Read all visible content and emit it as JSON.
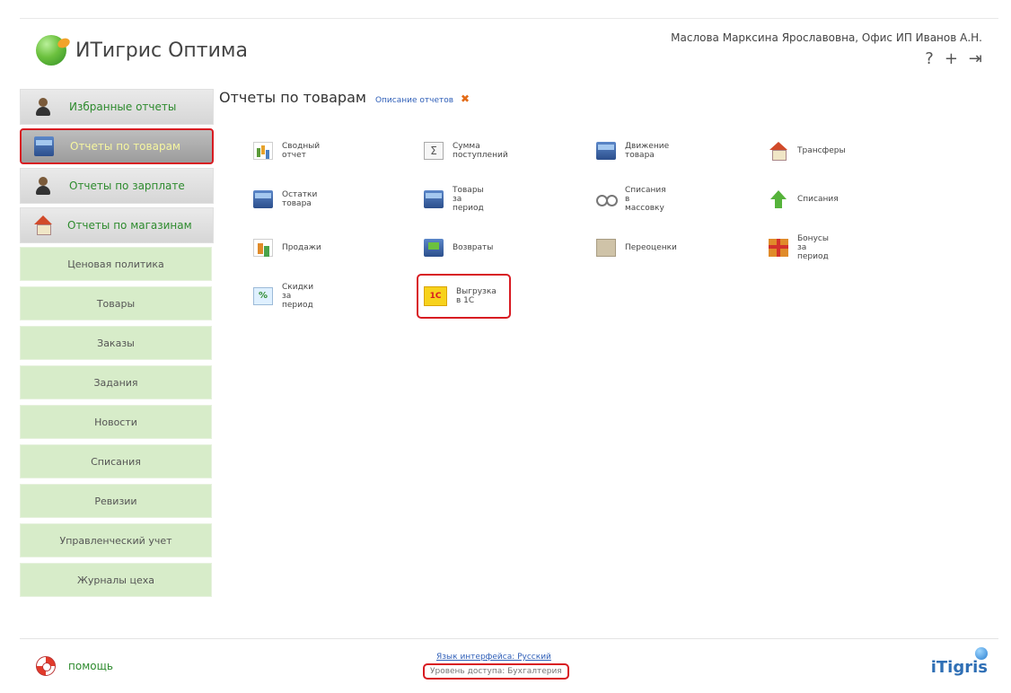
{
  "header": {
    "app_title": "ИТигрис Оптима",
    "user": "Маслова Марксина Ярославовна, Офис ИП Иванов А.Н.",
    "icons": [
      "question-icon",
      "plus-icon",
      "logout-icon"
    ],
    "icon_glyphs": {
      "help": "?",
      "add": "+",
      "logout": "⇥"
    }
  },
  "sidebar": {
    "big_items": [
      {
        "label": "Избранные отчеты",
        "icon": "person-icon"
      },
      {
        "label": "Отчеты по товарам",
        "icon": "box-icon",
        "active": true
      },
      {
        "label": "Отчеты по зарплате",
        "icon": "person-chart-icon"
      },
      {
        "label": "Отчеты по магазинам",
        "icon": "house-icon"
      }
    ],
    "menu_items": [
      "Ценовая политика",
      "Товары",
      "Заказы",
      "Задания",
      "Новости",
      "Списания",
      "Ревизии",
      "Управленческий учет",
      "Журналы цеха"
    ]
  },
  "main": {
    "title": "Отчеты по товарам",
    "description_link": "Описание отчетов",
    "close_glyph": "✖",
    "reports": [
      {
        "label": "Сводный отчет",
        "icon": "chart-icon"
      },
      {
        "label": "Сумма поступлений",
        "icon": "sigma-icon",
        "glyph": "Σ"
      },
      {
        "label": "Движение товара",
        "icon": "box-icon"
      },
      {
        "label": "Трансферы",
        "icon": "house-icon"
      },
      {
        "label": "Остатки товара",
        "icon": "box-icon"
      },
      {
        "label": "Товары за период",
        "icon": "box-list-icon"
      },
      {
        "label": "Списания в массовку",
        "icon": "glasses-icon"
      },
      {
        "label": "Списания",
        "icon": "arrow-up-icon"
      },
      {
        "label": "Продажи",
        "icon": "bar-chart-icon"
      },
      {
        "label": "Возвраты",
        "icon": "returns-icon"
      },
      {
        "label": "Переоценки",
        "icon": "price-tag-icon"
      },
      {
        "label": "Бонусы за период",
        "icon": "gift-icon"
      },
      {
        "label": "Скидки за период",
        "icon": "discount-icon",
        "glyph": "%"
      },
      {
        "label": "Выгрузка в 1С",
        "icon": "1c-icon",
        "glyph": "1С",
        "highlighted": true
      }
    ]
  },
  "footer": {
    "help": "помощь",
    "language": "Язык интерфейса: Русский",
    "access_level": "Уровень доступа: Бухгалтерия",
    "brand": "iTigris"
  },
  "colors": {
    "accent_green": "#2e8b2e",
    "menu_green": "#d7ecc9",
    "highlight_red": "#d81b22",
    "link_blue": "#2f5fb8"
  }
}
